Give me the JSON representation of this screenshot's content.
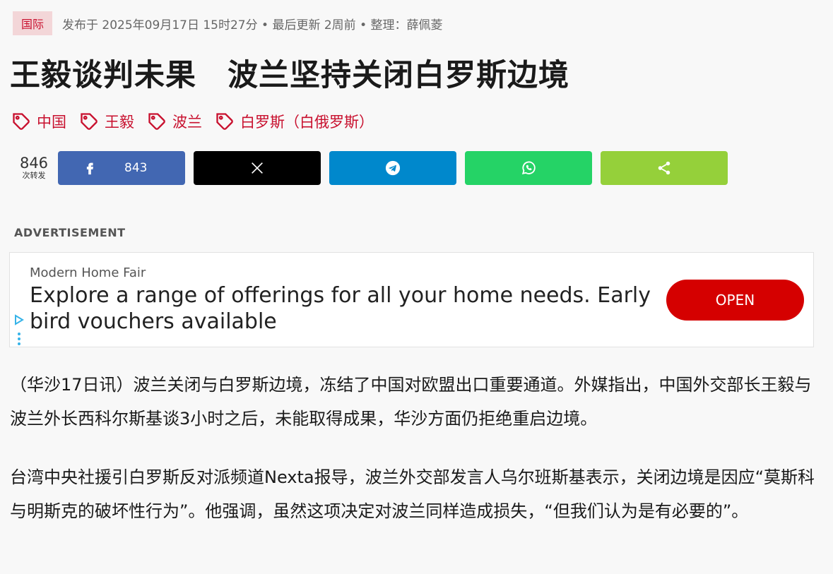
{
  "article": {
    "category": "国际",
    "meta": "发布于 2025年09月17日 15时27分 • 最后更新 2周前 • 整理：薛佩菱",
    "title": "王毅谈判未果　波兰坚持关闭白罗斯边境",
    "tags": [
      "中国",
      "王毅",
      "波兰",
      "白罗斯（白俄罗斯）"
    ]
  },
  "share": {
    "count": "846",
    "count_label": "次转发",
    "facebook_count": "843",
    "buttons": [
      "facebook",
      "x",
      "telegram",
      "whatsapp",
      "share"
    ]
  },
  "ad": {
    "label": "ADVERTISEMENT",
    "advertiser": "Modern Home Fair",
    "body": "Explore a range of offerings for all your home needs. Early bird vouchers available",
    "cta": "OPEN"
  },
  "paragraphs": [
    "（华沙17日讯）波兰关闭与白罗斯边境，冻结了中国对欧盟出口重要通道。外媒指出，中国外交部长王毅与波兰外长西科尔斯基谈3小时之后，未能取得成果，华沙方面仍拒绝重启边境。",
    "台湾中央社援引白罗斯反对派频道Nexta报导，波兰外交部发言人乌尔班斯基表示，关闭边境是因应“莫斯科与明斯克的破坏性行为”。他强调，虽然这项决定对波兰同样造成损失，“但我们认为是有必要的”。"
  ],
  "colors": {
    "accent": "#c8102e",
    "facebook": "#4267b2",
    "x": "#000000",
    "telegram": "#0088cc",
    "whatsapp": "#25d366",
    "share": "#95d03a",
    "ad_cta": "#d50000"
  }
}
